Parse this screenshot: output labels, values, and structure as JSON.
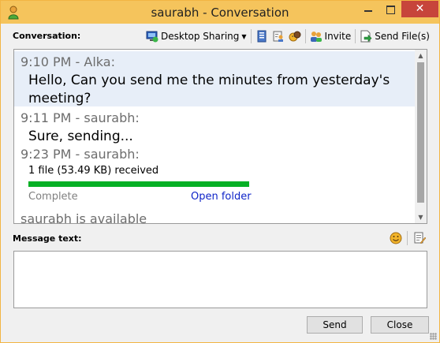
{
  "window": {
    "title": "saurabh - Conversation",
    "close_glyph": "✕"
  },
  "conversation": {
    "label": "Conversation:"
  },
  "toolbar": {
    "desktop_sharing": "Desktop Sharing",
    "invite": "Invite",
    "send_files": "Send File(s)"
  },
  "messages": [
    {
      "header": "9:10 PM - Alka:",
      "text": "Hello, Can you send me the minutes from yesterday's meeting?"
    },
    {
      "header": "9:11 PM - saurabh:",
      "text": "Sure, sending..."
    },
    {
      "header": "9:23 PM - saurabh:"
    }
  ],
  "file_transfer": {
    "text": "1 file (53.49 KB) received",
    "progress": 1.0,
    "status": "Complete",
    "link": "Open folder"
  },
  "presence": "saurabh is available",
  "compose": {
    "label": "Message text:",
    "value": ""
  },
  "buttons": {
    "send": "Send",
    "close": "Close"
  },
  "colors": {
    "titlebar": "#f5c45c",
    "close_button": "#c7453b",
    "progress": "#06b025",
    "link": "#0f24c8",
    "highlight": "#e7eef8"
  }
}
